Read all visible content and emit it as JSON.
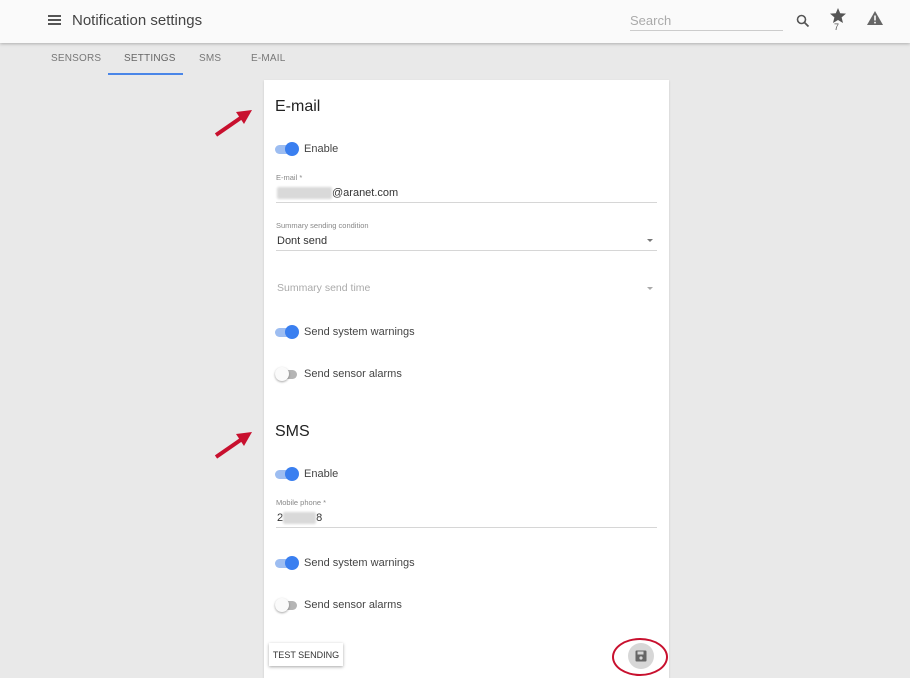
{
  "header": {
    "title": "Notification settings",
    "search_placeholder": "Search",
    "favorites_count": "7"
  },
  "tabs": [
    "SENSORS",
    "SETTINGS",
    "SMS",
    "E-MAIL"
  ],
  "active_tab": "SETTINGS",
  "email_section": {
    "title": "E-mail",
    "enable_label": "Enable",
    "enabled": true,
    "email_label": "E-mail *",
    "email_value_masked": "xxxxxxxxxx",
    "email_value_domain": "@aranet.com",
    "summary_condition_label": "Summary sending condition",
    "summary_condition_value": "Dont send",
    "summary_time_placeholder": "Summary send time",
    "system_warnings_label": "Send system warnings",
    "system_warnings": true,
    "sensor_alarms_label": "Send sensor alarms",
    "sensor_alarms": false
  },
  "sms_section": {
    "title": "SMS",
    "enable_label": "Enable",
    "enabled": true,
    "phone_label": "Mobile phone *",
    "phone_value_start": "2",
    "phone_value_masked": "xxxxxx",
    "phone_value_end": "8",
    "system_warnings_label": "Send system warnings",
    "system_warnings": true,
    "sensor_alarms_label": "Send sensor alarms",
    "sensor_alarms": false
  },
  "actions": {
    "test_label": "TEST SENDING"
  },
  "colors": {
    "accent": "#3a7ff0",
    "annotation": "#c8102e"
  }
}
